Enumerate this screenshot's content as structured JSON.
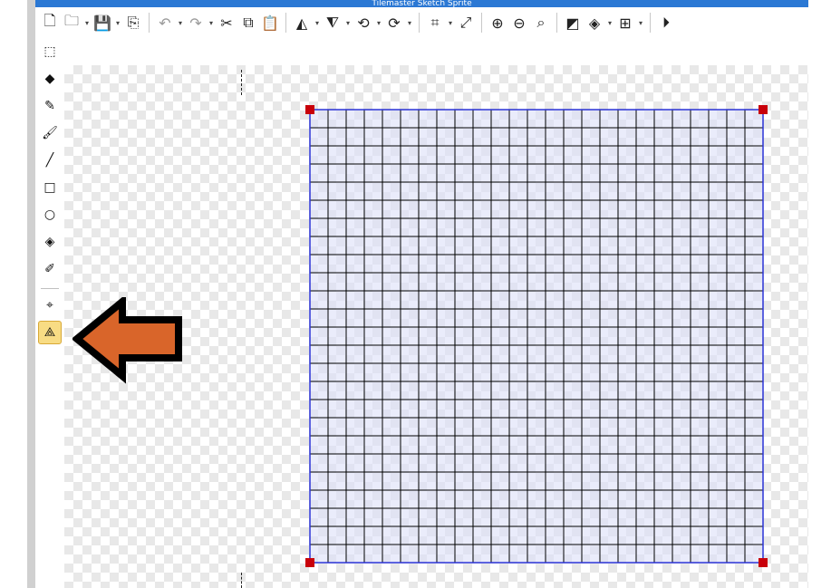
{
  "window": {
    "title": "Tilemaster Sketch Sprite"
  },
  "toolbar": {
    "groups": [
      [
        {
          "name": "new-file-icon",
          "glyph": "🗋"
        },
        {
          "name": "open-folder-icon",
          "glyph": "🗀",
          "dropdown": true
        },
        {
          "name": "save-icon",
          "glyph": "💾",
          "dropdown": true
        },
        {
          "name": "export-icon",
          "glyph": "⎘"
        }
      ],
      [
        {
          "name": "undo-icon",
          "glyph": "↶",
          "dropdown": true,
          "dim": true
        },
        {
          "name": "redo-icon",
          "glyph": "↷",
          "dropdown": true,
          "dim": true
        },
        {
          "name": "cut-icon",
          "glyph": "✂"
        },
        {
          "name": "copy-icon",
          "glyph": "⧉"
        },
        {
          "name": "paste-icon",
          "glyph": "📋"
        }
      ],
      [
        {
          "name": "flip-horizontal-icon",
          "glyph": "◭",
          "dropdown": true
        },
        {
          "name": "flip-vertical-icon",
          "glyph": "⧨",
          "dropdown": true
        },
        {
          "name": "rotate-left-icon",
          "glyph": "⟲",
          "dropdown": true
        },
        {
          "name": "rotate-right-icon",
          "glyph": "⟳",
          "dropdown": true
        }
      ],
      [
        {
          "name": "crop-icon",
          "glyph": "⌗",
          "dropdown": true
        },
        {
          "name": "resize-icon",
          "glyph": "⤢"
        }
      ],
      [
        {
          "name": "zoom-in-icon",
          "glyph": "⊕"
        },
        {
          "name": "zoom-out-icon",
          "glyph": "⊖"
        },
        {
          "name": "zoom-actual-icon",
          "glyph": "⌕"
        }
      ],
      [
        {
          "name": "color-swap-icon",
          "glyph": "◩"
        },
        {
          "name": "layers-icon",
          "glyph": "◈",
          "dropdown": true
        },
        {
          "name": "grid-icon",
          "glyph": "⊞",
          "dropdown": true
        }
      ],
      [
        {
          "name": "play-icon",
          "glyph": "⏵"
        }
      ]
    ]
  },
  "selection_tool": {
    "name": "rectangle-select-icon",
    "glyph": "⬚"
  },
  "toolbox": {
    "tools": [
      {
        "name": "eraser-icon",
        "glyph": "◆"
      },
      {
        "name": "pencil-icon",
        "glyph": "✎"
      },
      {
        "name": "brush-icon",
        "glyph": "🖌"
      },
      {
        "name": "line-icon",
        "glyph": "╱"
      },
      {
        "name": "rectangle-icon",
        "glyph": "□"
      },
      {
        "name": "ellipse-icon",
        "glyph": "○"
      },
      {
        "name": "fill-bucket-icon",
        "glyph": "◈"
      },
      {
        "name": "eyedropper-icon",
        "glyph": "✐"
      },
      {
        "sep": true
      },
      {
        "name": "point-tool-icon",
        "glyph": "⌖"
      },
      {
        "name": "polygon-node-icon",
        "glyph": "⟁",
        "active": true
      }
    ]
  },
  "grid": {
    "rows": 25,
    "cols": 25,
    "line_color": "#000000",
    "fill_color": "#dce0f8",
    "border_color": "#2a33d6",
    "handle_color": "#c8000a"
  },
  "annotation": {
    "arrow_fill": "#d9652a",
    "arrow_stroke": "#000000"
  }
}
